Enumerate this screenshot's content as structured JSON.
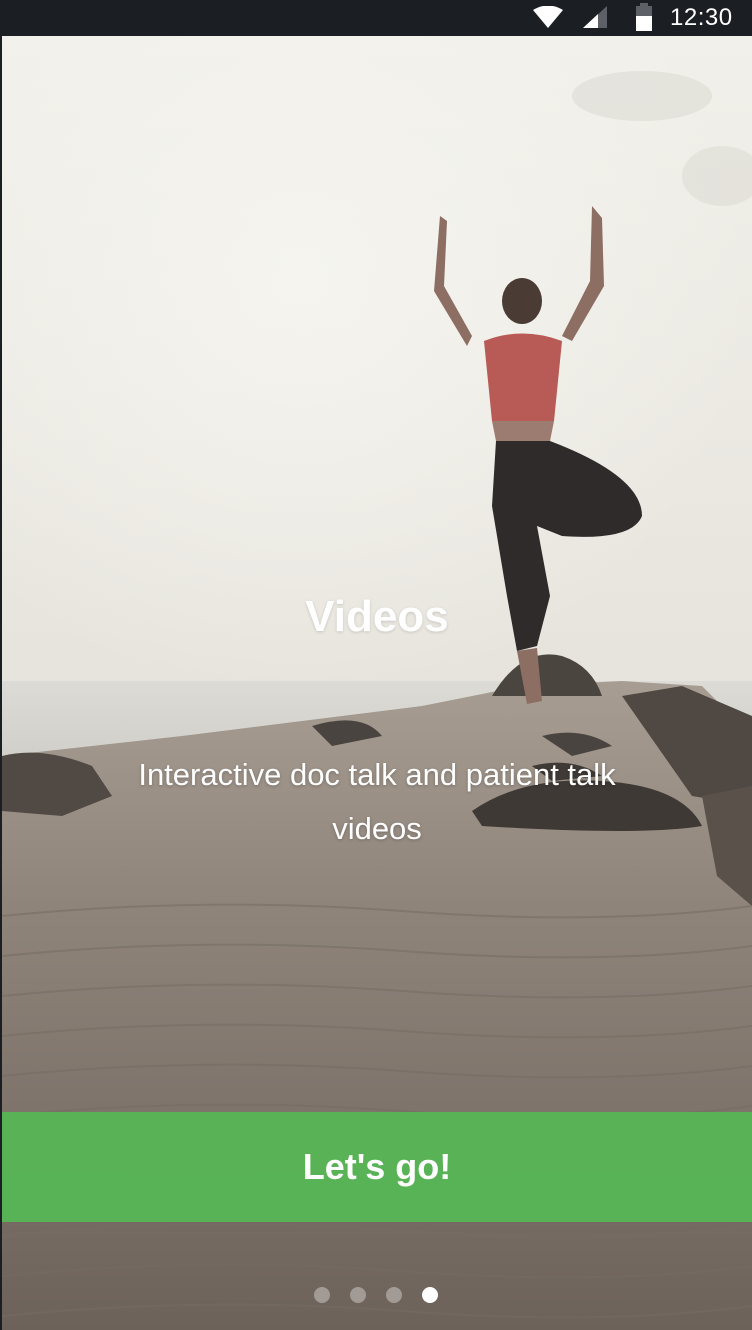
{
  "status_bar": {
    "time": "12:30",
    "icons": [
      "wifi-icon",
      "cellular-signal-icon",
      "battery-icon"
    ]
  },
  "slide": {
    "title": "Videos",
    "description": "Interactive doc talk and patient talk videos",
    "background_image": "yoga-pose-on-pier-photo"
  },
  "cta": {
    "label": "Let's go!",
    "color": "#56b855"
  },
  "pager": {
    "total": 4,
    "active_index": 3
  }
}
